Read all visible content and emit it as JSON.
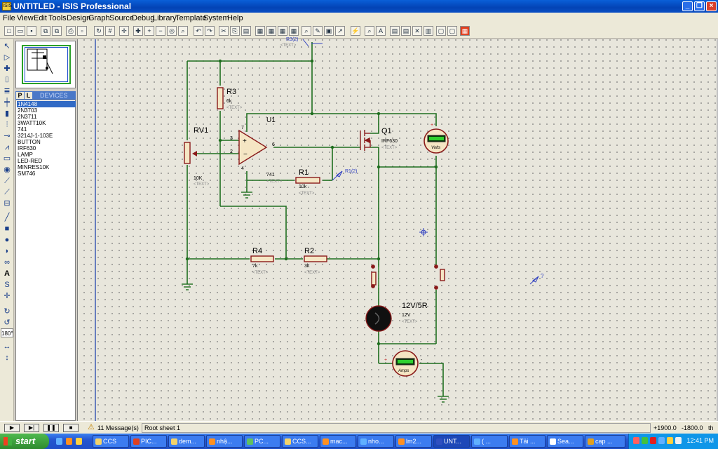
{
  "window": {
    "title": "UNTITLED - ISIS Professional",
    "app_badge": "ISIS"
  },
  "menu": [
    "File",
    "View",
    "Edit",
    "Tools",
    "Design",
    "Graph",
    "Source",
    "Debug",
    "Library",
    "Template",
    "System",
    "Help"
  ],
  "toolbar_icons": [
    "new-icon",
    "open-icon",
    "save-icon",
    "import-icon",
    "export-icon",
    "print-icon",
    "setarea-icon",
    "refresh-icon",
    "grid-icon",
    "origin-icon",
    "pan-icon",
    "zoom-in-icon",
    "zoom-out-icon",
    "zoom-all-icon",
    "zoom-area-icon",
    "undo-icon",
    "redo-icon",
    "cut-icon",
    "copy-icon",
    "paste-icon",
    "block-copy-icon",
    "block-move-icon",
    "block-rotate-icon",
    "block-delete-icon",
    "pick-icon",
    "make-device-icon",
    "packaging-icon",
    "decompose-icon",
    "wire-autoroute-icon",
    "search-icon",
    "property-assign-icon",
    "new-sheet-icon",
    "remove-sheet-icon",
    "exit-parent-icon",
    "bill-of-materials-icon",
    "electrical-rules-icon",
    "netlist-icon"
  ],
  "device_panel": {
    "tab_p": "P",
    "tab_l": "L",
    "title": "DEVICES",
    "selected": "1N4148",
    "devices": [
      "1N4148",
      "2N3703",
      "2N3711",
      "3WATT10K",
      "741",
      "3214J-1-103E",
      "BUTTON",
      "IRF630",
      "LAMP",
      "LED-RED",
      "MINRES10K",
      "SM746"
    ]
  },
  "schematic": {
    "rv1": {
      "ref": "RV1",
      "value": "10K",
      "text": "<TEXT>"
    },
    "r3": {
      "ref": "R3",
      "value": "6k",
      "text": "<TEXT>"
    },
    "u1": {
      "ref": "U1",
      "value": "741",
      "text": "<TEXT>",
      "pin3": "3",
      "pin2": "2",
      "pin6": "6",
      "pin7": "7",
      "pin4": "4"
    },
    "r1": {
      "ref": "R1",
      "value": "10k",
      "text": "<TEXT>"
    },
    "q1": {
      "ref": "Q1",
      "value": "IRF630",
      "text": "<TEXT>"
    },
    "r4": {
      "ref": "R4",
      "value": "7k",
      "text": "<TEXT>"
    },
    "r2": {
      "ref": "R2",
      "value": "3k",
      "text": "<TEXT>"
    },
    "lamp": {
      "ref": "12V/5R",
      "value": "12V",
      "text": "<TEXT>"
    },
    "voltmeter": {
      "label": "Volts",
      "plus": "+",
      "minus": "-"
    },
    "ammeter": {
      "label": "Amps",
      "plus": "+",
      "minus": "-"
    },
    "probe_r1": "R1(2)",
    "probe_top": "R3(2)",
    "probe_top_text": "<TEXT>",
    "probe_q": "?"
  },
  "status": {
    "messages": "11 Message(s)",
    "sheet": "Root sheet 1",
    "coord_x": "+1900.0",
    "coord_y": "-1800.0",
    "units": "th"
  },
  "taskbar": {
    "start": "start",
    "tasks": [
      "CCS",
      "PIC...",
      "dem...",
      "nhậ...",
      "PC...",
      "CCS...",
      "mac...",
      "nho...",
      "lm2...",
      "UNT...",
      "( ...",
      "Tải ...",
      "Sea...",
      "cap ..."
    ],
    "active_task": "UNT...",
    "clock": "12:41 PM"
  }
}
